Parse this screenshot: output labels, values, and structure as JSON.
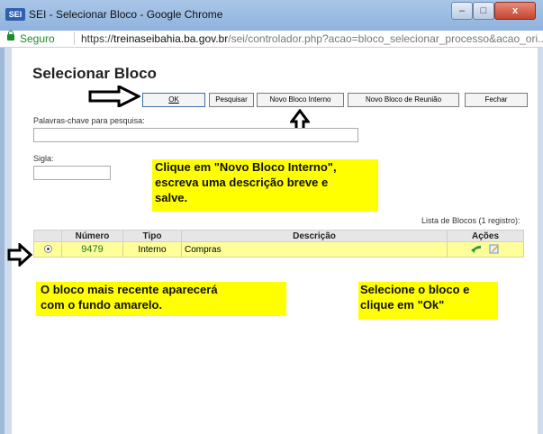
{
  "window": {
    "icon_text": "SEI",
    "title": "SEI - Selecionar Bloco - Google Chrome",
    "controls": {
      "minimize": "–",
      "maximize": "□",
      "close": "x"
    }
  },
  "address": {
    "secure_label": "Seguro",
    "url_scheme": "https://",
    "url_host": "treinaseibahia.ba.gov.br",
    "url_path": "/sei/controlador.php?acao=bloco_selecionar_processo&acao_ori..."
  },
  "page": {
    "title": "Selecionar Bloco",
    "buttons": {
      "ok": "OK",
      "pesquisar": "Pesquisar",
      "novo_bloco_interno": "Novo Bloco Interno",
      "novo_bloco_reuniao": "Novo Bloco de Reunião",
      "fechar": "Fechar"
    },
    "search_label": "Palavras-chave para pesquisa:",
    "search_value": "",
    "sigla_label": "Sigla:",
    "sigla_value": ""
  },
  "notes": {
    "note1_line1": "Clique em \"Novo Bloco Interno\",",
    "note1_line2": "escreva uma descrição breve e",
    "note1_line3": "salve.",
    "note2_line1": "O bloco mais recente aparecerá",
    "note2_line2": "com o fundo amarelo.",
    "note3_line1": "Selecione o bloco e",
    "note3_line2": "clique em \"Ok\""
  },
  "table": {
    "caption": "Lista de Blocos (1 registro):",
    "headers": {
      "numero": "Número",
      "tipo": "Tipo",
      "descricao": "Descrição",
      "acoes": "Ações"
    },
    "rows": [
      {
        "numero": "9479",
        "tipo": "Interno",
        "descricao": "Compras",
        "selected": true,
        "actions": [
          "green-arrow-icon",
          "edit-icon"
        ]
      }
    ]
  },
  "colors": {
    "note_bg": "#ffff00",
    "row_highlight": "#ffff9a",
    "number_green": "#1d7a24"
  }
}
